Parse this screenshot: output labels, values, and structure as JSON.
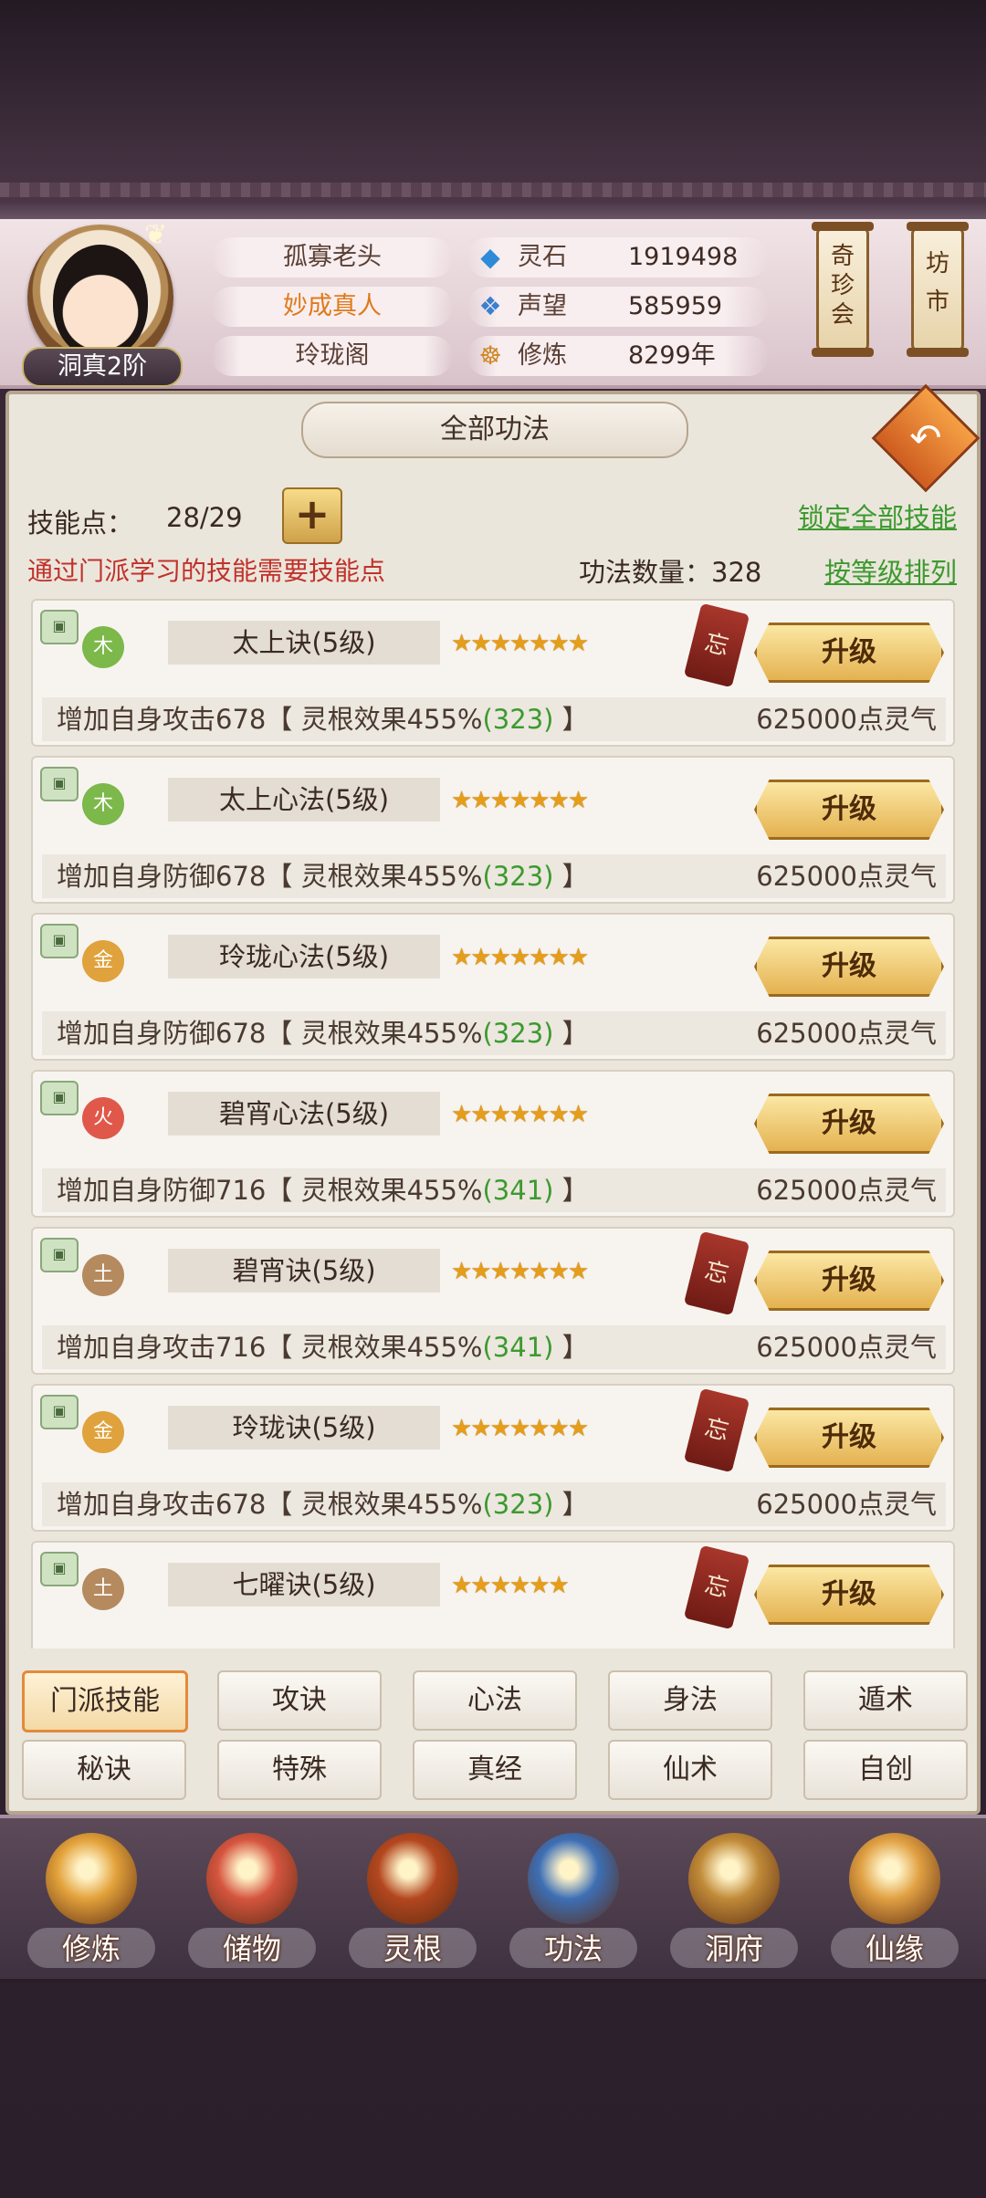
{
  "header": {
    "rank": "洞真2阶",
    "character_name": "孤寡老头",
    "title": "妙成真人",
    "sect": "玲珑阁",
    "stats": [
      {
        "icon": "spirit-stone-icon",
        "label": "灵石",
        "value": "1919498"
      },
      {
        "icon": "reputation-crystal-icon",
        "label": "声望",
        "value": "585959"
      },
      {
        "icon": "meditation-icon",
        "label": "修炼",
        "value": "8299年"
      }
    ],
    "shortcuts": [
      {
        "label": "奇珍会",
        "lines": [
          "奇",
          "珍",
          "会"
        ]
      },
      {
        "label": "坊市",
        "lines": [
          "坊",
          "市"
        ]
      }
    ]
  },
  "panel": {
    "title": "全部功法",
    "skill_points_label": "技能点：",
    "skill_points_value": "28/29",
    "lock_all": "锁定全部技能",
    "warning": "通过门派学习的技能需要技能点",
    "technique_count_label": "功法数量：328",
    "sort_by_level": "按等级排列"
  },
  "skills": [
    {
      "element": "木",
      "element_color": "#7cb84a",
      "name": "太上诀(5级)",
      "stars": 7,
      "forget": "忘",
      "upgrade": "升级",
      "desc": "增加自身攻击678【 灵根效果455%",
      "bonus": "(323)",
      "desc_end": " 】",
      "cost": "625000点灵气"
    },
    {
      "element": "木",
      "element_color": "#7cb84a",
      "name": "太上心法(5级)",
      "stars": 7,
      "forget": "",
      "upgrade": "升级",
      "desc": "增加自身防御678【 灵根效果455%",
      "bonus": "(323)",
      "desc_end": " 】",
      "cost": "625000点灵气"
    },
    {
      "element": "金",
      "element_color": "#e0a23c",
      "name": "玲珑心法(5级)",
      "stars": 7,
      "forget": "",
      "upgrade": "升级",
      "desc": "增加自身防御678【 灵根效果455%",
      "bonus": "(323)",
      "desc_end": " 】",
      "cost": "625000点灵气"
    },
    {
      "element": "火",
      "element_color": "#e0584a",
      "name": "碧宵心法(5级)",
      "stars": 7,
      "forget": "",
      "upgrade": "升级",
      "desc": "增加自身防御716【 灵根效果455%",
      "bonus": "(341)",
      "desc_end": " 】",
      "cost": "625000点灵气"
    },
    {
      "element": "土",
      "element_color": "#b58a5e",
      "name": "碧宵诀(5级)",
      "stars": 7,
      "forget": "忘",
      "upgrade": "升级",
      "desc": "增加自身攻击716【 灵根效果455%",
      "bonus": "(341)",
      "desc_end": " 】",
      "cost": "625000点灵气"
    },
    {
      "element": "金",
      "element_color": "#e0a23c",
      "name": "玲珑诀(5级)",
      "stars": 7,
      "forget": "忘",
      "upgrade": "升级",
      "desc": "增加自身攻击678【 灵根效果455%",
      "bonus": "(323)",
      "desc_end": " 】",
      "cost": "625000点灵气"
    },
    {
      "element": "土",
      "element_color": "#b58a5e",
      "name": "七曜诀(5级)",
      "stars": 6,
      "forget": "忘",
      "upgrade": "升级",
      "desc": "",
      "bonus": "",
      "desc_end": "",
      "cost": ""
    }
  ],
  "tabs": [
    {
      "label": "门派技能",
      "active": true
    },
    {
      "label": "攻诀",
      "active": false
    },
    {
      "label": "心法",
      "active": false
    },
    {
      "label": "身法",
      "active": false
    },
    {
      "label": "遁术",
      "active": false
    },
    {
      "label": "秘诀",
      "active": false
    },
    {
      "label": "特殊",
      "active": false
    },
    {
      "label": "真经",
      "active": false
    },
    {
      "label": "仙术",
      "active": false
    },
    {
      "label": "自创",
      "active": false
    }
  ],
  "bottom_nav": [
    {
      "label": "修炼",
      "icon": "cultivate-icon",
      "color": "#e2a13a"
    },
    {
      "label": "储物",
      "icon": "storage-bag-icon",
      "color": "#d5553f"
    },
    {
      "label": "灵根",
      "icon": "spirit-root-icon",
      "color": "#b3471f"
    },
    {
      "label": "功法",
      "icon": "technique-book-icon",
      "color": "#3d6fb5"
    },
    {
      "label": "洞府",
      "icon": "cave-mansion-icon",
      "color": "#c08a38"
    },
    {
      "label": "仙缘",
      "icon": "fortune-gourd-icon",
      "color": "#e0a042"
    }
  ]
}
